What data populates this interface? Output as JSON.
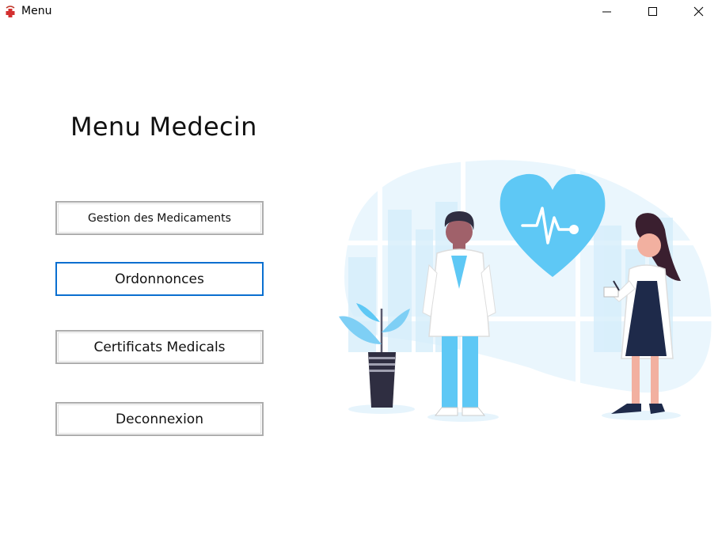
{
  "window": {
    "title": "Menu",
    "icon": "medical-cross-icon",
    "controls": [
      "minimize-icon",
      "maximize-icon",
      "close-icon"
    ]
  },
  "page": {
    "title": "Menu Medecin"
  },
  "buttons": [
    {
      "label": "Gestion des Medicaments",
      "focused": false
    },
    {
      "label": "Ordonnonces",
      "focused": true
    },
    {
      "label": "Certificats Medicals",
      "focused": false
    },
    {
      "label": "Deconnexion",
      "focused": false
    }
  ],
  "illustration": {
    "subject": "doctors-heart-illustration",
    "colors": {
      "accent": "#5ec8f5",
      "light": "#eaf6fd",
      "dark": "#2f2e41",
      "skin": "#a0616a"
    }
  }
}
